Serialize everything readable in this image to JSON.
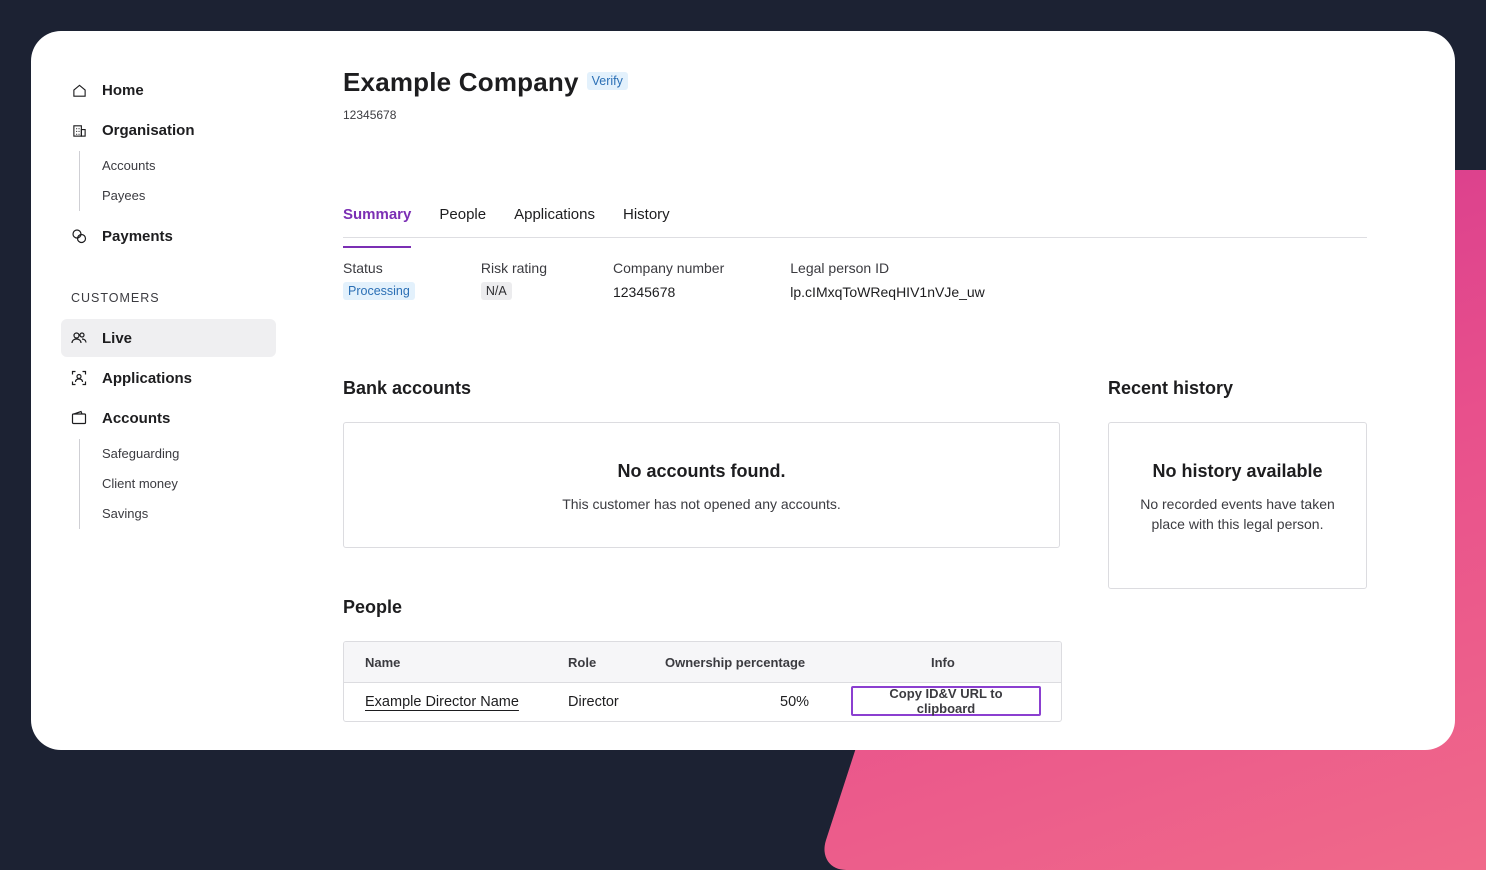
{
  "sidebar": {
    "items": [
      {
        "label": "Home",
        "icon": "home-icon"
      },
      {
        "label": "Organisation",
        "icon": "building-icon"
      },
      {
        "label": "Payments",
        "icon": "coins-icon"
      }
    ],
    "organisation_sub": [
      "Accounts",
      "Payees"
    ],
    "section_label": "CUSTOMERS",
    "customer_items": [
      {
        "label": "Live",
        "icon": "users-icon",
        "active": true
      },
      {
        "label": "Applications",
        "icon": "scan-user-icon"
      },
      {
        "label": "Accounts",
        "icon": "wallet-icon"
      }
    ],
    "accounts_sub": [
      "Safeguarding",
      "Client money",
      "Savings"
    ]
  },
  "header": {
    "title": "Example Company",
    "verify_badge": "Verify",
    "subtitle": "12345678"
  },
  "tabs": [
    {
      "label": "Summary",
      "active": true
    },
    {
      "label": "People"
    },
    {
      "label": "Applications"
    },
    {
      "label": "History"
    }
  ],
  "details": {
    "status_label": "Status",
    "status_value": "Processing",
    "risk_label": "Risk rating",
    "risk_value": "N/A",
    "company_number_label": "Company number",
    "company_number_value": "12345678",
    "legal_id_label": "Legal person ID",
    "legal_id_value": "lp.cIMxqToWReqHIV1nVJe_uw"
  },
  "bank_accounts": {
    "heading": "Bank accounts",
    "empty_title": "No accounts found.",
    "empty_text": "This customer has not opened any accounts."
  },
  "recent_history": {
    "heading": "Recent history",
    "empty_title": "No history available",
    "empty_text": "No recorded events have taken place with this legal person."
  },
  "people": {
    "heading": "People",
    "columns": [
      "Name",
      "Role",
      "Ownership percentage",
      "Info"
    ],
    "rows": [
      {
        "name": "Example Director Name",
        "role": "Director",
        "ownership": "50%",
        "action": "Copy ID&V URL to clipboard"
      }
    ]
  },
  "colors": {
    "accent": "#7b2fb4",
    "badge_blue_bg": "#e3f1fc",
    "badge_blue_text": "#2b6fb5",
    "page_bg": "#1c2233"
  }
}
